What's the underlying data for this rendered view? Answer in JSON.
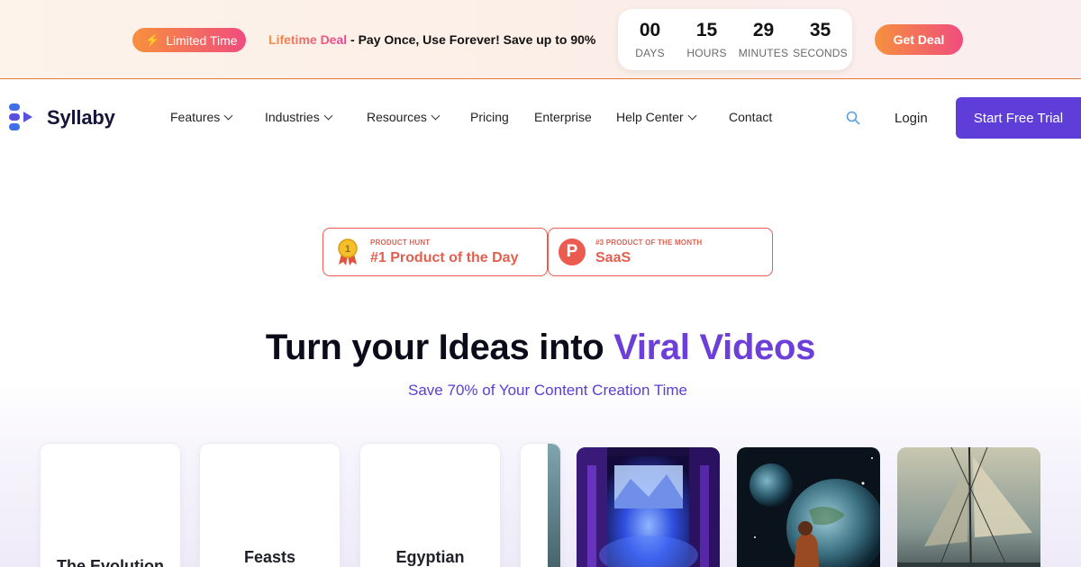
{
  "banner": {
    "limited_label": "Limited Time",
    "deal_highlight": "Lifetime Deal",
    "deal_rest": " - Pay Once, Use Forever! Save up to 90%",
    "countdown": [
      {
        "value": "00",
        "label": "DAYS"
      },
      {
        "value": "15",
        "label": "HOURS"
      },
      {
        "value": "29",
        "label": "MINUTES"
      },
      {
        "value": "35",
        "label": "SECONDS"
      }
    ],
    "cta": "Get Deal"
  },
  "header": {
    "logo": "Syllaby",
    "nav": [
      {
        "label": "Features",
        "dropdown": true
      },
      {
        "label": "Industries",
        "dropdown": true
      },
      {
        "label": "Resources",
        "dropdown": true
      },
      {
        "label": "Pricing",
        "dropdown": false
      },
      {
        "label": "Enterprise",
        "dropdown": false
      },
      {
        "label": "Help Center",
        "dropdown": true
      },
      {
        "label": "Contact",
        "dropdown": false
      }
    ],
    "login": "Login",
    "trial": "Start Free Trial"
  },
  "badges": [
    {
      "small": "PRODUCT HUNT",
      "big": "#1 Product of the Day",
      "medal_number": "1"
    },
    {
      "small": "#3 PRODUCT OF THE MONTH",
      "big": "SaaS",
      "ph_letter": "P"
    }
  ],
  "hero": {
    "headline_main": "Turn your Ideas into ",
    "headline_accent": "Viral Videos",
    "subline": "Save 70% of Your Content Creation Time"
  },
  "cards": [
    {
      "title": "The Evolution"
    },
    {
      "title": "Feasts"
    },
    {
      "title": "Egyptian"
    }
  ],
  "colors": {
    "brand_purple": "#5f3dd8",
    "accent_orange": "#f7913d",
    "accent_pink": "#f04c7e",
    "badge_red": "#ec5b50"
  }
}
